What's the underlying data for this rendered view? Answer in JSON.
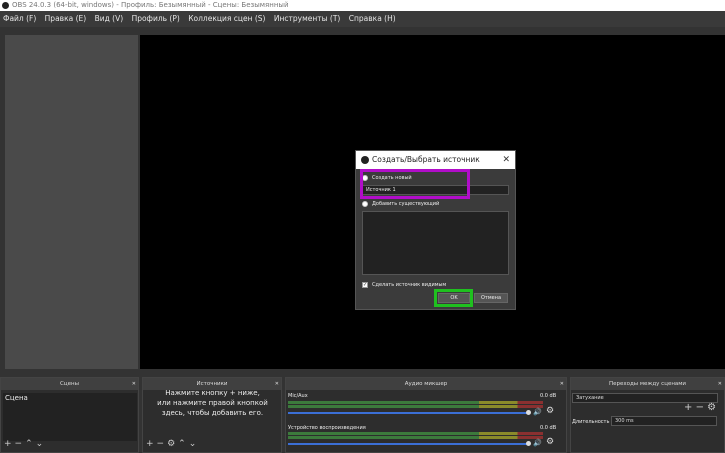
{
  "window": {
    "title": "OBS 24.0.3 (64-bit, windows) - Профиль: Безымянный - Сцены: Безымянный"
  },
  "menu": [
    "Файл (F)",
    "Правка (E)",
    "Вид (V)",
    "Профиль (P)",
    "Коллекция сцен (S)",
    "Инструменты (T)",
    "Справка (H)"
  ],
  "dialog": {
    "title": "Создать/Выбрать источник",
    "create_new": "Создать новый",
    "name_value": "Источник 1",
    "add_existing": "Добавить существующий",
    "make_visible": "Сделать источник видимым",
    "ok": "OK",
    "cancel": "Отмена"
  },
  "docks": {
    "scenes": {
      "title": "Сцены",
      "items": [
        "Сцена"
      ]
    },
    "sources": {
      "title": "Источники",
      "hint": "Нажмите кнопку + ниже,\nили нажмите правой кнопкой\nздесь, чтобы добавить его."
    },
    "mixer": {
      "title": "Аудио микшер",
      "channels": [
        {
          "name": "Mic/Aux",
          "db": "0.0 dB"
        },
        {
          "name": "Устройство воспроизведения",
          "db": "0.0 dB"
        }
      ]
    },
    "transitions": {
      "title": "Переходы между сценами",
      "selected": "Затухание",
      "duration_label": "Длительность",
      "duration_value": "300 ms"
    }
  },
  "colors": {
    "highlight_magenta": "#b10dc9",
    "highlight_green": "#1fc01f"
  }
}
